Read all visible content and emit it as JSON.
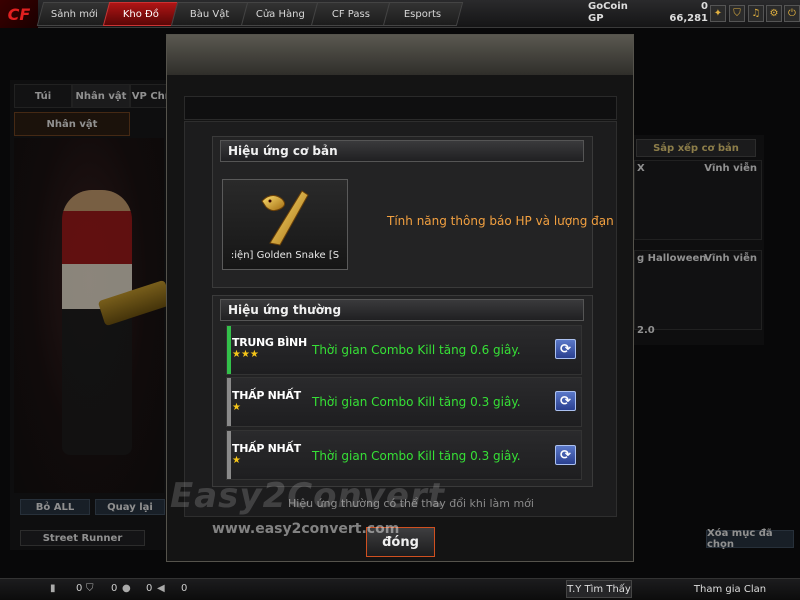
{
  "topbar": {
    "logo": "CF",
    "tabs": [
      "Sảnh mới",
      "Kho Đồ",
      "Bàu Vật",
      "Cửa Hàng",
      "CF Pass",
      "Esports"
    ],
    "active_tab": "Kho Đồ",
    "gocoin_label": "GoCoin",
    "gocoin_value": "0",
    "gp_label": "GP",
    "gp_value": "66,281"
  },
  "left_panel": {
    "tabs": [
      "Túi",
      "Nhân vật",
      "VP Chí"
    ],
    "subtab": "Nhân vật",
    "remove_all": "Bỏ ALL",
    "back": "Quay lại",
    "character_name": "Street Runner"
  },
  "right_panel": {
    "sort_label": "Sắp xếp cơ bản",
    "cards": [
      {
        "name": "X",
        "duration": "Vĩnh viễn"
      },
      {
        "name": "g Halloween",
        "duration": "Vĩnh viễn",
        "extra": "2.0"
      }
    ],
    "clear_button": "Xóa mục đã chọn"
  },
  "bottombar": {
    "counts": [
      "0",
      "0",
      "0",
      "0"
    ],
    "search_button": "T.Y Tìm Thấy",
    "clan_button": "Tham gia Clan"
  },
  "modal": {
    "basic_title": "Hiệu ứng cơ bản",
    "item_name": ":iện] Golden Snake [S",
    "feature_text": "Tính năng thông báo HP và lượng đạn",
    "normal_title": "Hiệu ứng thường",
    "effects": [
      {
        "tier": "TRUNG BÌNH",
        "stars": "★★★",
        "text": "Thời gian Combo Kill tăng 0.6 giây.",
        "tier_color": "#33c04a"
      },
      {
        "tier": "THẤP NHẤT",
        "stars": "★",
        "text": "Thời gian Combo Kill tăng 0.3 giây.",
        "tier_color": "#8a8a8a"
      },
      {
        "tier": "THẤP NHẤT",
        "stars": "★",
        "text": "Thời gian Combo Kill tăng 0.3 giây.",
        "tier_color": "#8a8a8a"
      }
    ],
    "hint": "Hiệu ứng thường có thể thay đổi khi làm mới",
    "close_label": "đóng"
  },
  "watermark": {
    "brand": "Easy2Convert",
    "url": "www.easy2convert.com"
  },
  "colors": {
    "accent_red": "#b01515",
    "feature_orange": "#f2a040",
    "effect_green": "#36e036",
    "star_gold": "#f5c518"
  }
}
